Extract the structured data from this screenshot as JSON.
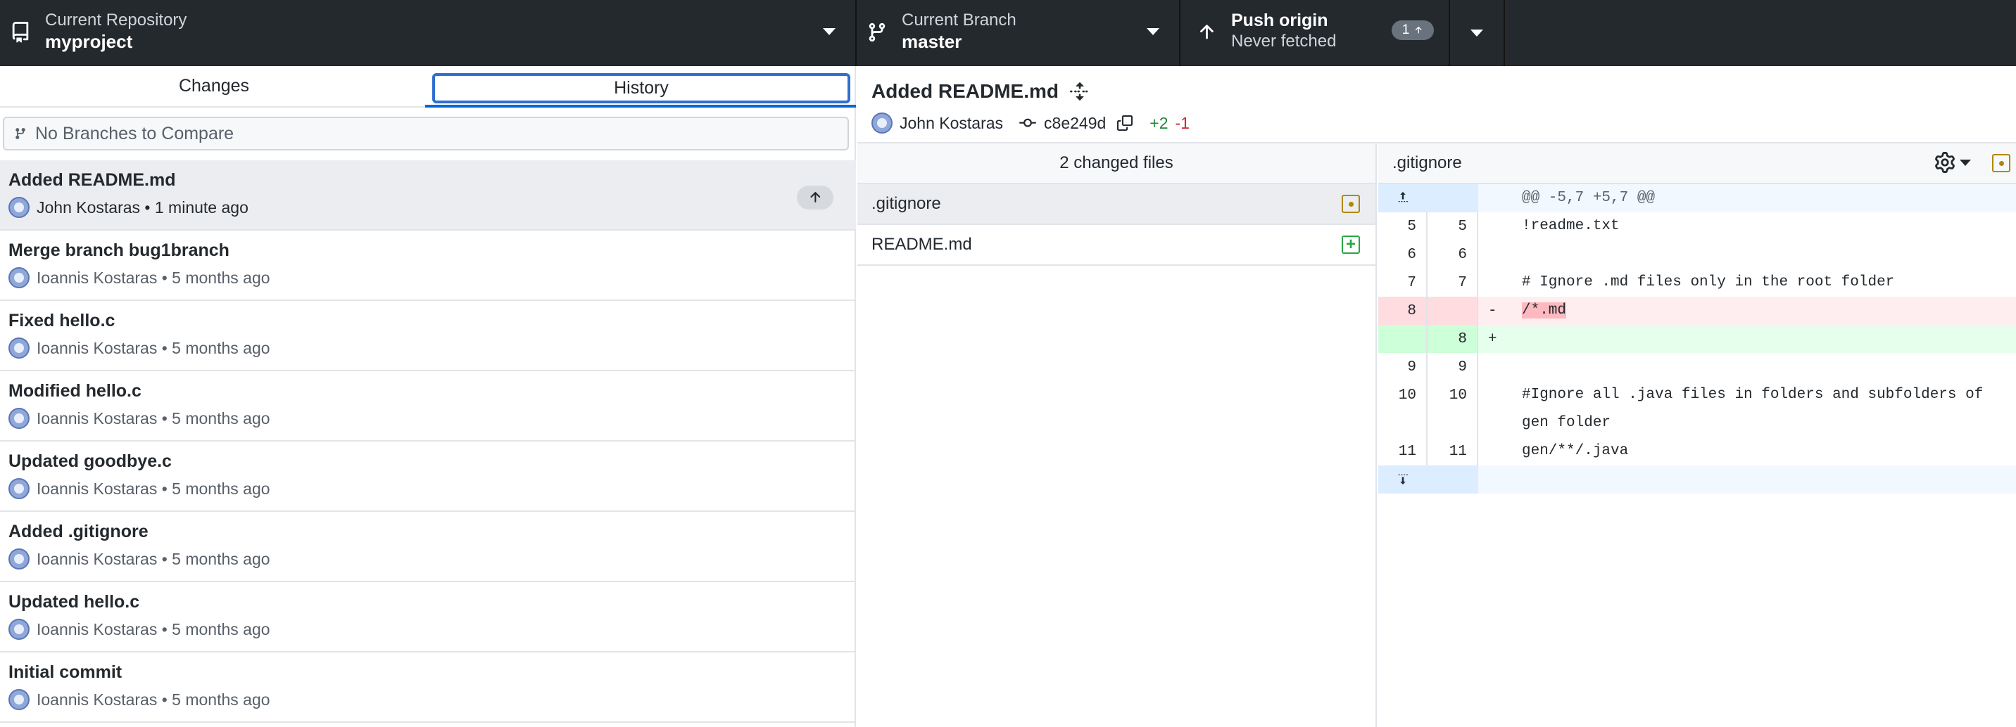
{
  "toolbar": {
    "repository": {
      "label": "Current Repository",
      "value": "myproject"
    },
    "branch": {
      "label": "Current Branch",
      "value": "master"
    },
    "push": {
      "label": "Push origin",
      "value": "Never fetched",
      "badge_count": "1"
    }
  },
  "tabs": {
    "changes": "Changes",
    "history": "History",
    "selected": "History"
  },
  "compare": {
    "placeholder": "No Branches to Compare"
  },
  "commits": [
    {
      "title": "Added README.md",
      "author": "John Kostaras",
      "time": "1 minute ago",
      "selected": true,
      "unpushed": true
    },
    {
      "title": "Merge branch bug1branch",
      "author": "Ioannis Kostaras",
      "time": "5 months ago"
    },
    {
      "title": "Fixed hello.c",
      "author": "Ioannis Kostaras",
      "time": "5 months ago"
    },
    {
      "title": "Modified hello.c",
      "author": "Ioannis Kostaras",
      "time": "5 months ago"
    },
    {
      "title": "Updated goodbye.c",
      "author": "Ioannis Kostaras",
      "time": "5 months ago"
    },
    {
      "title": "Added .gitignore",
      "author": "Ioannis Kostaras",
      "time": "5 months ago"
    },
    {
      "title": "Updated hello.c",
      "author": "Ioannis Kostaras",
      "time": "5 months ago"
    },
    {
      "title": "Initial commit",
      "author": "Ioannis Kostaras",
      "time": "5 months ago"
    }
  ],
  "commit_detail": {
    "title": "Added README.md",
    "author": "John Kostaras",
    "sha": "c8e249d",
    "additions": "+2",
    "deletions": "-1"
  },
  "files": {
    "header": "2 changed files",
    "items": [
      {
        "name": ".gitignore",
        "status": "modified",
        "selected": true
      },
      {
        "name": "README.md",
        "status": "added"
      }
    ]
  },
  "diff": {
    "filename": ".gitignore",
    "hunk_header": "@@ -5,7 +5,7 @@",
    "lines": [
      {
        "old": "5",
        "new": "5",
        "sign": "",
        "text": "!readme.txt",
        "type": "context"
      },
      {
        "old": "6",
        "new": "6",
        "sign": "",
        "text": "",
        "type": "context"
      },
      {
        "old": "7",
        "new": "7",
        "sign": "",
        "text": "# Ignore .md files only in the root folder",
        "type": "context"
      },
      {
        "old": "8",
        "new": "",
        "sign": "-",
        "text": "/*.md",
        "type": "del"
      },
      {
        "old": "",
        "new": "8",
        "sign": "+",
        "text": "",
        "type": "add"
      },
      {
        "old": "9",
        "new": "9",
        "sign": "",
        "text": "",
        "type": "context"
      },
      {
        "old": "10",
        "new": "10",
        "sign": "",
        "text": "#Ignore all .java files in folders and subfolders of gen folder",
        "type": "context"
      },
      {
        "old": "11",
        "new": "11",
        "sign": "",
        "text": "gen/**/.java",
        "type": "context"
      }
    ]
  },
  "icons": {
    "repo": "repo-icon",
    "branch": "git-branch-icon",
    "push": "arrow-up-icon",
    "settings": "gear-icon",
    "copy": "copy-icon",
    "commit": "git-commit-icon",
    "expand": "unfold-icon"
  },
  "colors": {
    "toolbar_bg": "#24292e",
    "accent": "#0366d6",
    "added": "#22863a",
    "deleted": "#cb2431",
    "modified": "#b08800"
  }
}
